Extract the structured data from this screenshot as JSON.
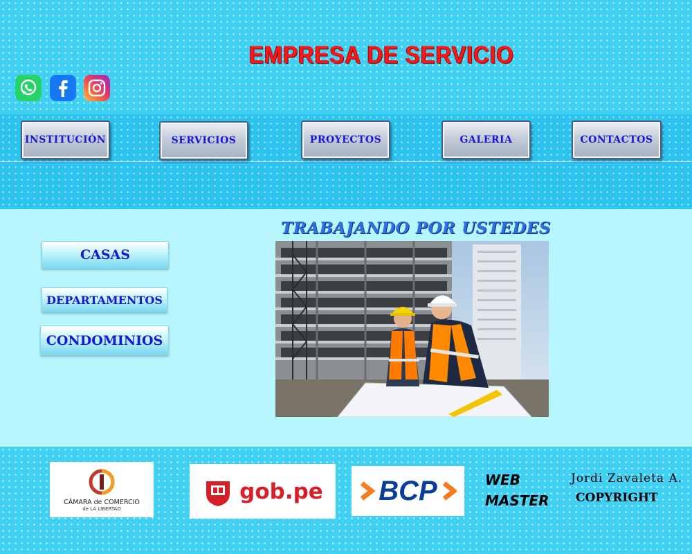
{
  "header": {
    "title": "EMPRESA DE SERVICIO",
    "social": [
      {
        "icon": "whatsapp-icon",
        "color": "#25d366"
      },
      {
        "icon": "facebook-icon",
        "color": "#1877f2"
      },
      {
        "icon": "instagram-icon",
        "color": "#d92e7f"
      }
    ]
  },
  "nav": {
    "items": [
      {
        "label": "INSTITUCIÓN"
      },
      {
        "label": "SERVICIOS"
      },
      {
        "label": "PROYECTOS"
      },
      {
        "label": "GALERIA"
      },
      {
        "label": "CONTACTOS"
      }
    ]
  },
  "main": {
    "tagline": "TRABAJANDO POR USTEDES",
    "side_menu": [
      {
        "label": "CASAS"
      },
      {
        "label": "DEPARTAMENTOS"
      },
      {
        "label": "CONDOMINIOS"
      }
    ]
  },
  "footer": {
    "logos": {
      "camara_line1": "CÁMARA de COMERCIO",
      "camara_line2": "de LA LIBERTAD",
      "gob": "gob.pe",
      "bcp": "BCP"
    },
    "webmaster_line1": "WEB",
    "webmaster_line2": "MASTER",
    "author": "Jordi Zavaleta A.",
    "copyright": "COPYRIGHT"
  },
  "colors": {
    "title": "#ff1515",
    "nav_text": "#1a16d8",
    "tagline": "#2f6fe0",
    "background": "#3fd0f4"
  }
}
